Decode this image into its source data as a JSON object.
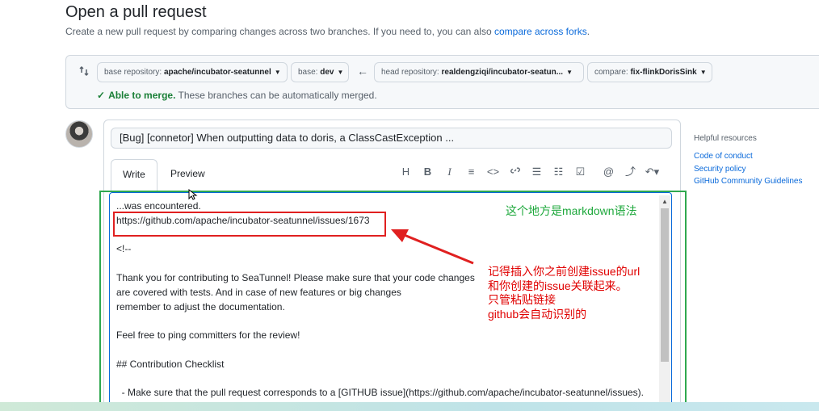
{
  "page": {
    "title": "Open a pull request",
    "subtitle_prefix": "Create a new pull request by comparing changes across two branches. If you need to, you can also ",
    "subtitle_link": "compare across forks",
    "subtitle_suffix": "."
  },
  "compare": {
    "base_repo_label": "base repository: ",
    "base_repo_value": "apache/incubator-seatunnel",
    "base_label": "base: ",
    "base_value": "dev",
    "head_repo_label": "head repository: ",
    "head_repo_value": "realdengziqi/incubator-seatun...",
    "compare_label": "compare: ",
    "compare_value": "fix-flinkDorisSink",
    "merge_status": "Able to merge.",
    "merge_detail": " These branches can be automatically merged."
  },
  "form": {
    "title_value": "[Bug] [connetor] When outputting data to doris, a ClassCastException ...",
    "tabs": [
      "Write",
      "Preview"
    ],
    "toolbar_icons": [
      "heading-icon",
      "bold-icon",
      "italic-icon",
      "quote-icon",
      "code-icon",
      "link-icon",
      "unordered-list-icon",
      "ordered-list-icon",
      "task-list-icon",
      "mention-icon",
      "reference-icon",
      "reply-icon"
    ],
    "toolbar_glyphs": [
      "H",
      "B",
      "I",
      "≡",
      "<>",
      "🔗",
      "☰",
      "☷",
      "☑",
      "@",
      "⤴",
      "↶▾"
    ]
  },
  "editor": {
    "lines": [
      "...was encountered.",
      "https://github.com/apache/incubator-seatunnel/issues/1673",
      "",
      "<!--",
      "",
      "Thank you for contributing to SeaTunnel! Please make sure that your code changes",
      "are covered with tests. And in case of new features or big changes",
      "remember to adjust the documentation.",
      "",
      "Feel free to ping committers for the review!",
      "",
      "## Contribution Checklist",
      "",
      "  - Make sure that the pull request corresponds to a [GITHUB issue](https://github.com/apache/incubator-seatunnel/issues)."
    ]
  },
  "annotations": {
    "green_note": "这个地方是markdown语法",
    "red_note_lines": [
      "记得插入你之前创建issue的url",
      "和你创建的issue关联起来。",
      "只管粘贴链接",
      "github会自动识别的"
    ]
  },
  "sidebar": {
    "title": "Helpful resources",
    "links": [
      "Code of conduct",
      "Security policy",
      "GitHub Community Guidelines"
    ]
  }
}
